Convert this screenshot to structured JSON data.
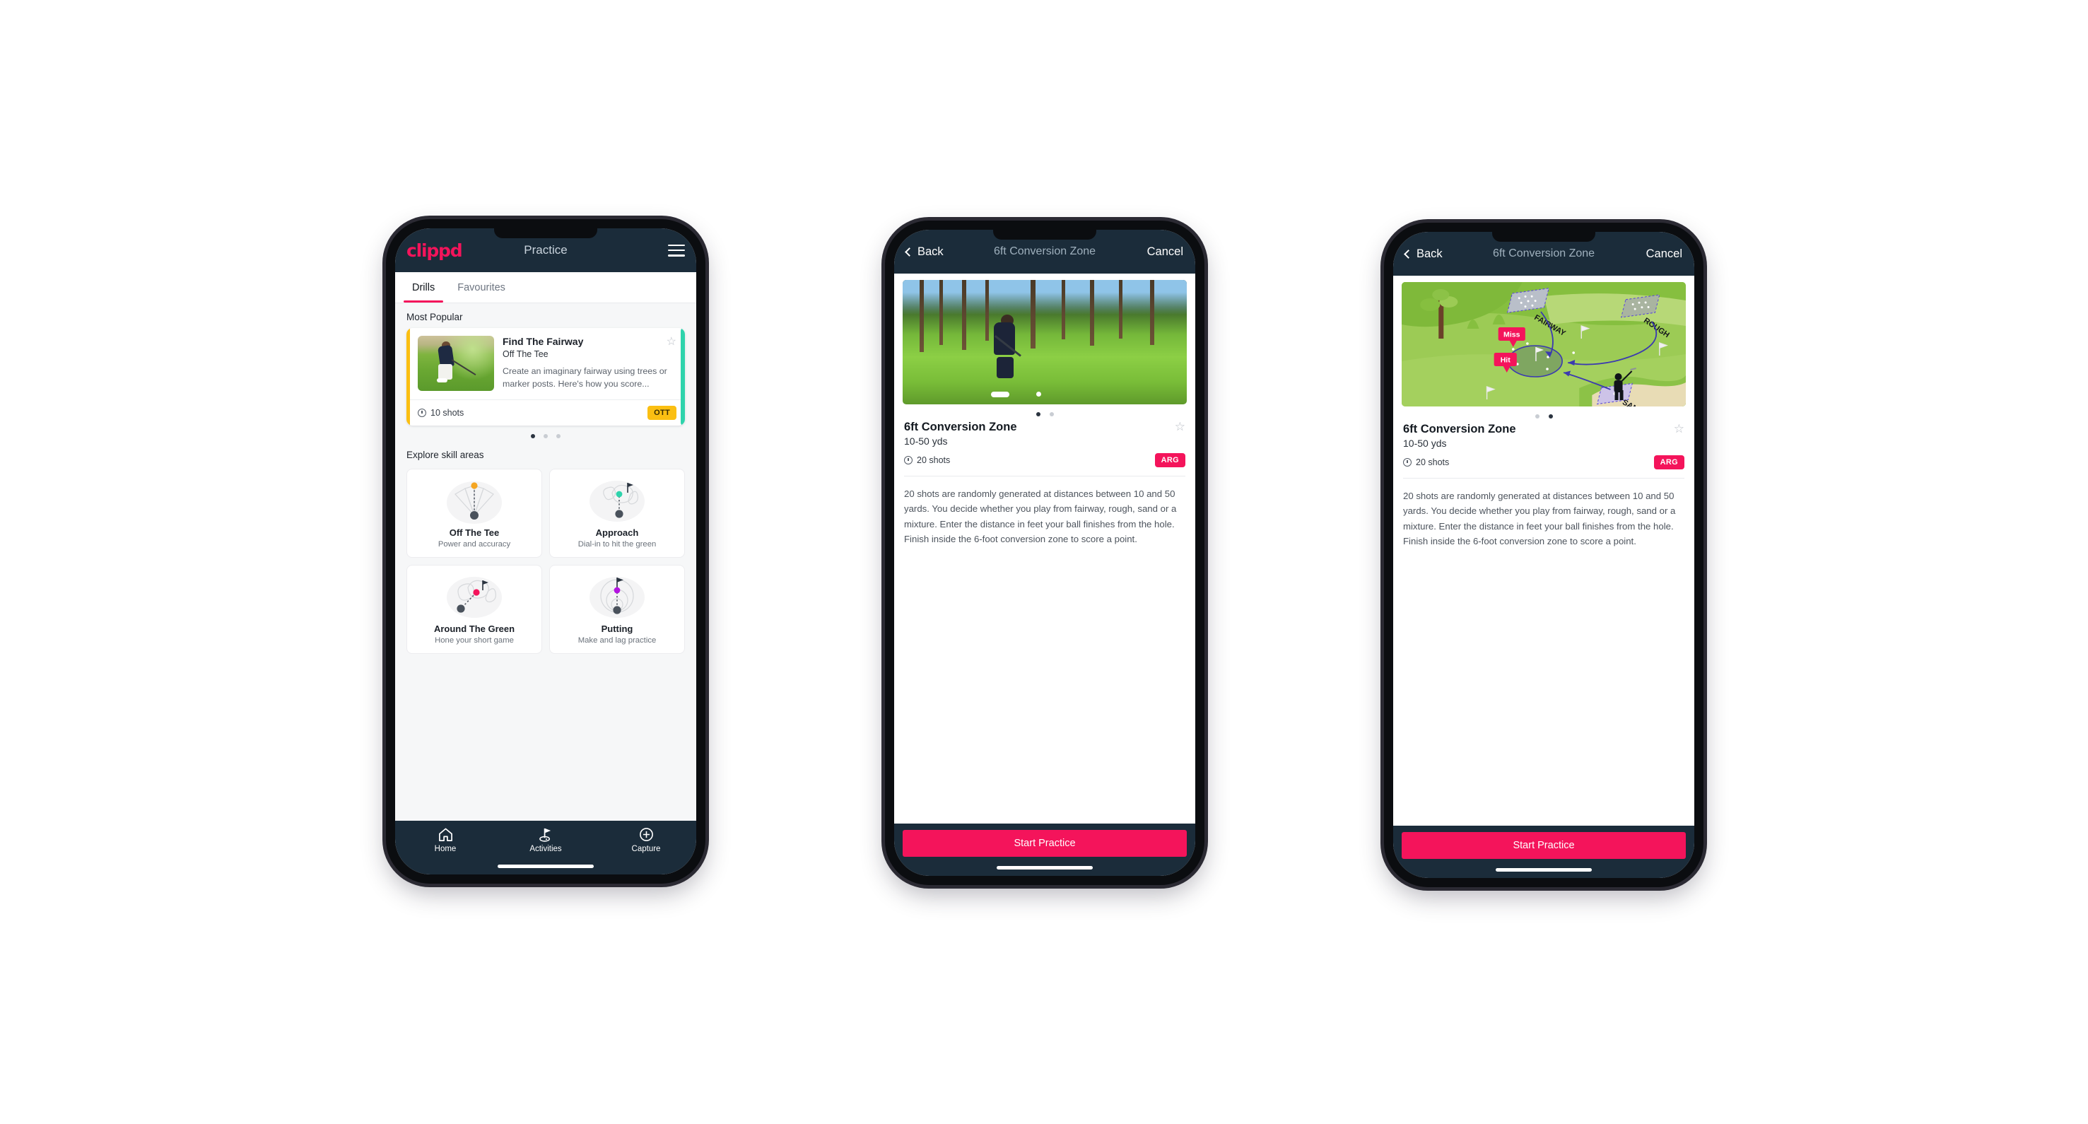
{
  "screens": {
    "practice": {
      "appbar": {
        "brand": "clippd",
        "title": "Practice",
        "menu_icon": "hamburger-icon"
      },
      "tabs": [
        {
          "label": "Drills",
          "active": true
        },
        {
          "label": "Favourites",
          "active": false
        }
      ],
      "most_popular_label": "Most Popular",
      "drill_card": {
        "title": "Find The Fairway",
        "subtitle": "Off The Tee",
        "description": "Create an imaginary fairway using trees or marker posts. Here's how you score...",
        "shots": "10 shots",
        "chip": "OTT",
        "chip_color": "#fbbf12",
        "accent_color": "#fbbf12",
        "next_card_accent": "#2ed3ac",
        "favourite_icon": "star-outline-icon"
      },
      "carousel_dots": {
        "count": 3,
        "active_index": 0
      },
      "explore_label": "Explore skill areas",
      "skills": [
        {
          "name": "Off The Tee",
          "desc": "Power and accuracy",
          "icon": "tee-fan-icon",
          "accent": "#f5a623"
        },
        {
          "name": "Approach",
          "desc": "Dial-in to hit the green",
          "icon": "approach-green-icon",
          "accent": "#2ed3ac"
        },
        {
          "name": "Around The Green",
          "desc": "Hone your short game",
          "icon": "around-green-icon",
          "accent": "#f4145b"
        },
        {
          "name": "Putting",
          "desc": "Make and lag practice",
          "icon": "putting-rings-icon",
          "accent": "#b413e0"
        }
      ],
      "bottom_nav": [
        {
          "label": "Home",
          "icon": "home-icon",
          "active": false
        },
        {
          "label": "Activities",
          "icon": "golf-flag-icon",
          "active": true
        },
        {
          "label": "Capture",
          "icon": "plus-circle-icon",
          "active": false
        }
      ]
    },
    "detail_photo": {
      "navbar": {
        "back": "Back",
        "title": "6ft Conversion Zone",
        "cancel": "Cancel",
        "back_icon": "chevron-left-icon"
      },
      "hero": "golfer-chipping-photo",
      "dots": {
        "count": 2,
        "active_index": 0
      },
      "title": "6ft Conversion Zone",
      "subtitle": "10-50 yds",
      "shots": "20 shots",
      "chip": "ARG",
      "chip_color": "#f4145b",
      "favourite_icon": "star-outline-icon",
      "description": "20 shots are randomly generated at distances between 10 and 50 yards. You decide whether you play from fairway, rough, sand or a mixture. Enter the distance in feet your ball finishes from the hole. Finish inside the 6-foot conversion zone to score a point.",
      "cta": "Start Practice"
    },
    "detail_diagram": {
      "navbar": {
        "back": "Back",
        "title": "6ft Conversion Zone",
        "cancel": "Cancel",
        "back_icon": "chevron-left-icon"
      },
      "hero": "course-diagram-illustration",
      "diagram_labels": {
        "fairway": "FAIRWAY",
        "rough": "ROUGH",
        "sand": "SAND",
        "miss": "Miss",
        "hit": "Hit"
      },
      "dots": {
        "count": 2,
        "active_index": 1
      },
      "title": "6ft Conversion Zone",
      "subtitle": "10-50 yds",
      "shots": "20 shots",
      "chip": "ARG",
      "chip_color": "#f4145b",
      "favourite_icon": "star-outline-icon",
      "description": "20 shots are randomly generated at distances between 10 and 50 yards. You decide whether you play from fairway, rough, sand or a mixture. Enter the distance in feet your ball finishes from the hole. Finish inside the 6-foot conversion zone to score a point.",
      "cta": "Start Practice"
    }
  },
  "theme": {
    "brand_pink": "#f4145b",
    "navy": "#1b2c3a",
    "teal": "#2ed3ac",
    "amber": "#fbbf12"
  }
}
